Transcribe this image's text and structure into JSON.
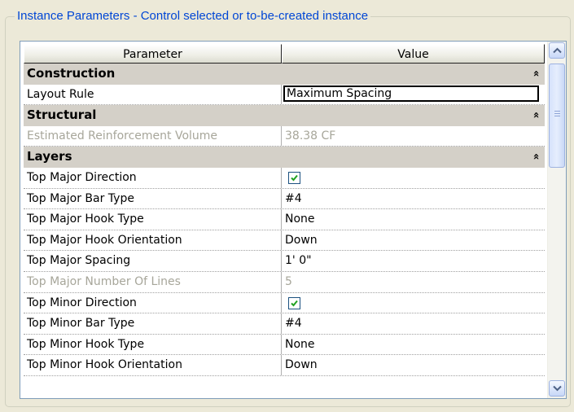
{
  "panel": {
    "title": "Instance Parameters - Control selected or to-be-created instance"
  },
  "table": {
    "col_parameter": "Parameter",
    "col_value": "Value"
  },
  "groups": [
    {
      "name": "Construction",
      "rows": [
        {
          "param": "Layout Rule",
          "value": "Maximum Spacing",
          "editing": true
        }
      ]
    },
    {
      "name": "Structural",
      "rows": [
        {
          "param": "Estimated Reinforcement Volume",
          "value": "38.38 CF",
          "disabled": true
        }
      ]
    },
    {
      "name": "Layers",
      "rows": [
        {
          "param": "Top Major Direction",
          "checked": true
        },
        {
          "param": "Top Major Bar Type",
          "value": "#4"
        },
        {
          "param": "Top Major Hook Type",
          "value": "None"
        },
        {
          "param": "Top Major Hook Orientation",
          "value": "Down"
        },
        {
          "param": "Top Major Spacing",
          "value": "1'  0\""
        },
        {
          "param": "Top Major Number Of Lines",
          "value": "5",
          "disabled": true
        },
        {
          "param": "Top Minor Direction",
          "checked": true
        },
        {
          "param": "Top Minor Bar Type",
          "value": "#4"
        },
        {
          "param": "Top Minor Hook Type",
          "value": "None"
        },
        {
          "param": "Top Minor Hook Orientation",
          "value": "Down"
        }
      ]
    }
  ],
  "collapse_glyph": "»",
  "icons": {
    "scroll_up": "chevron-up-icon",
    "scroll_down": "chevron-down-icon",
    "check": "check-icon"
  }
}
